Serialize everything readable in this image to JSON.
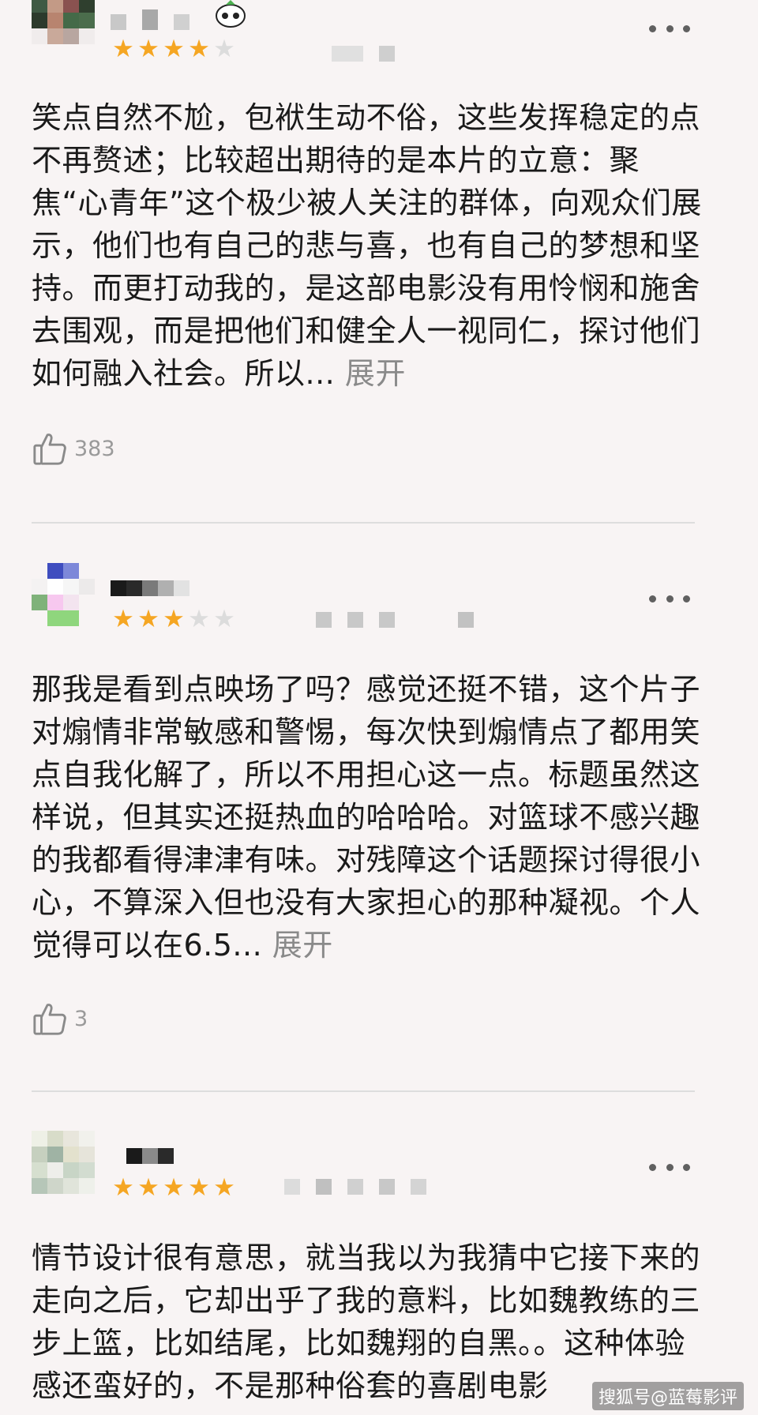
{
  "reviews": [
    {
      "rating": 4,
      "rating_max": 5,
      "text": "笑点自然不尬，包袱生动不俗，这些发挥稳定的点不再赘述；比较超出期待的是本片的立意：聚焦“心青年”这个极少被人关注的群体，向观众们展示，他们也有自己的悲与喜，也有自己的梦想和坚持。而更打动我的，是这部电影没有用怜悯和施舍去围观，而是把他们和健全人一视同仁，探讨他们如何融入社会。所以...",
      "expand_label": "展开",
      "likes": "383"
    },
    {
      "rating": 3,
      "rating_max": 5,
      "text": "那我是看到点映场了吗？感觉还挺不错，这个片子对煽情非常敏感和警惕，每次快到煽情点了都用笑点自我化解了，所以不用担心这一点。标题虽然这样说，但其实还挺热血的哈哈哈。对篮球不感兴趣的我都看得津津有味。对残障这个话题探讨得很小心，不算深入但也没有大家担心的那种凝视。个人觉得可以在6.5...",
      "expand_label": "展开",
      "likes": "3"
    },
    {
      "rating": 5,
      "rating_max": 5,
      "text": "情节设计很有意思，就当我以为我猜中它接下来的走向之后，它却出乎了我的意料，比如魏教练的三步上篮，比如结尾，比如魏翔的自黑。。这种体验感还蛮好的，不是那种俗套的喜剧电影",
      "expand_label": "",
      "likes": ""
    }
  ],
  "icons": {
    "more": "more-dots-icon",
    "like": "thumbs-up-icon",
    "star": "star-icon"
  },
  "colors": {
    "star_on": "#f5a623",
    "star_off": "#dcdcdc",
    "expand": "#8a8a8a",
    "background": "#f8f4f4"
  },
  "watermark": "搜狐号@蓝莓影评"
}
